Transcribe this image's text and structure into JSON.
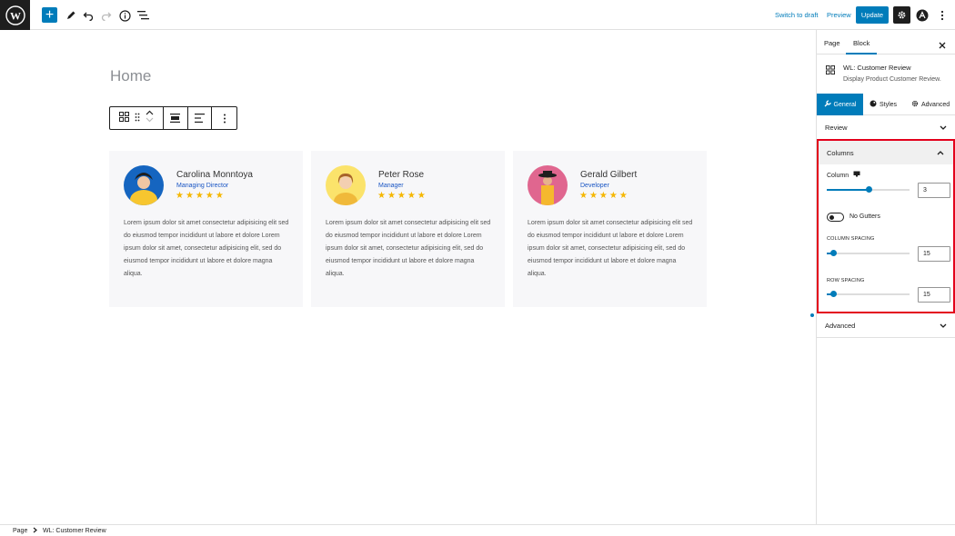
{
  "topbar": {
    "switch_to_draft": "Switch to draft",
    "preview": "Preview",
    "update": "Update"
  },
  "editor": {
    "page_title": "Home"
  },
  "cards": [
    {
      "name": "Carolina Monntoya",
      "role": "Managing Director",
      "stars": "★★★★★",
      "text": "Lorem ipsum dolor sit amet consectetur adipisicing elit sed do eiusmod tempor incididunt ut labore et dolore Lorem ipsum dolor sit amet, consectetur adipisicing elit, sed do eiusmod tempor incididunt ut labore et dolore magna aliqua.",
      "avatar_bg": "#1565c0",
      "avatar_fg": "#f7c62f"
    },
    {
      "name": "Peter Rose",
      "role": "Manager",
      "stars": "★★★★★",
      "text": "Lorem ipsum dolor sit amet consectetur adipisicing elit sed do eiusmod tempor incididunt ut labore et dolore Lorem ipsum dolor sit amet, consectetur adipisicing elit, sed do eiusmod tempor incididunt ut labore et dolore magna aliqua.",
      "avatar_bg": "#fbe36b",
      "avatar_fg": "#f0b93a"
    },
    {
      "name": "Gerald Gilbert",
      "role": "Developer",
      "stars": "★★★★★",
      "text": "Lorem ipsum dolor sit amet consectetur adipisicing elit sed do eiusmod tempor incididunt ut labore et dolore Lorem ipsum dolor sit amet, consectetur adipisicing elit, sed do eiusmod tempor incididunt ut labore et dolore magna aliqua.",
      "avatar_bg": "#e0668f",
      "avatar_fg": "#f5b82e"
    }
  ],
  "sidebar": {
    "tab_page": "Page",
    "tab_block": "Block",
    "block_title": "WL: Customer Review",
    "block_desc": "Display Product Customer Review.",
    "subtab_general": "General",
    "subtab_styles": "Styles",
    "subtab_advanced": "Advanced",
    "panel_review": "Review",
    "panel_columns": "Columns",
    "panel_advanced": "Advanced",
    "column_label": "Column",
    "column_value": "3",
    "column_fraction": 0.5,
    "no_gutters_label": "No Gutters",
    "column_spacing_label": "COLUMN SPACING",
    "column_spacing_value": "15",
    "column_spacing_fraction": 0.08,
    "row_spacing_label": "ROW SPACING",
    "row_spacing_value": "15",
    "row_spacing_fraction": 0.08
  },
  "footer": {
    "crumb_page": "Page",
    "crumb_block": "WL: Customer Review"
  },
  "colors": {
    "accent": "#007cba",
    "highlight_border": "#e3001b",
    "star": "#f5b700",
    "role": "#1a56c4"
  }
}
